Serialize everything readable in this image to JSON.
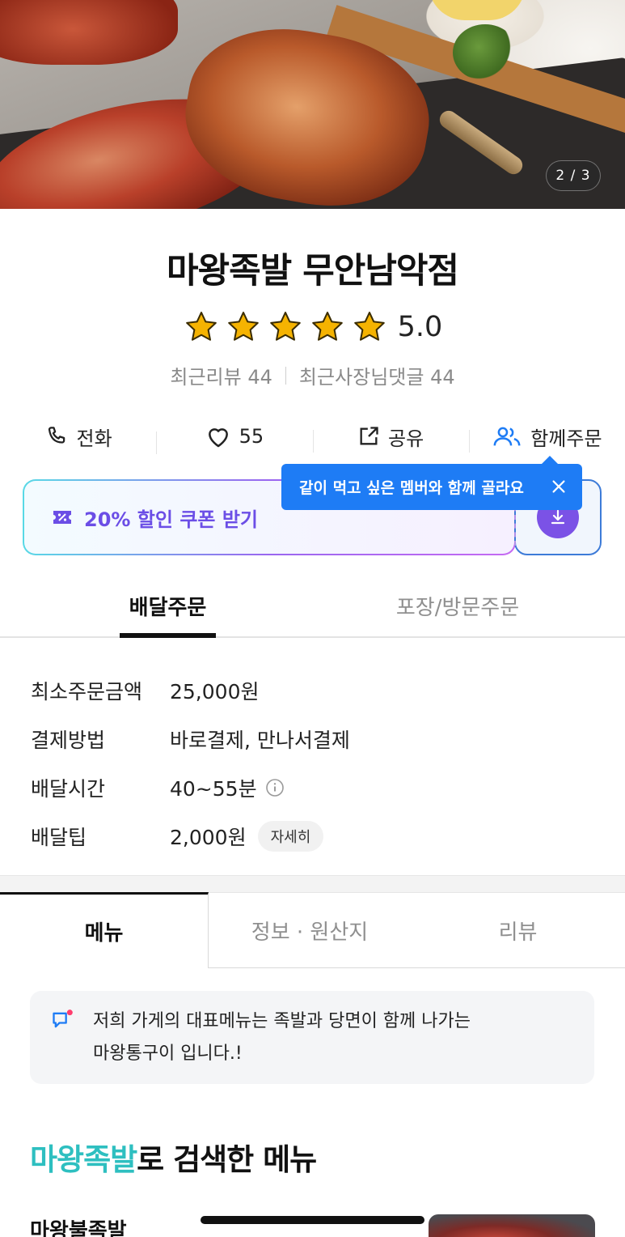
{
  "hero": {
    "counter": "2 / 3"
  },
  "store": {
    "name": "마왕족발 무안남악점",
    "rating": "5.0",
    "stars": 5,
    "recent_reviews": "최근리뷰 44",
    "owner_replies": "최근사장님댓글 44"
  },
  "actions": {
    "call": "전화",
    "like_count": "55",
    "share": "공유",
    "group_order": "함께주문"
  },
  "coupon": {
    "label": "20% 할인 쿠폰 받기"
  },
  "tooltip": {
    "text": "같이 먹고 싶은 멤버와 함께 골라요"
  },
  "order_tabs": {
    "delivery": "배달주문",
    "pickup": "포장/방문주문"
  },
  "info": {
    "rows": [
      {
        "key": "최소주문금액",
        "value": "25,000원"
      },
      {
        "key": "결제방법",
        "value": "바로결제, 만나서결제"
      },
      {
        "key": "배달시간",
        "value": "40~55분"
      },
      {
        "key": "배달팁",
        "value": "2,000원"
      }
    ],
    "detail_button": "자세히"
  },
  "content_tabs": {
    "menu": "메뉴",
    "info": "정보 · 원산지",
    "review": "리뷰"
  },
  "notice": {
    "line1": "저희 가게의 대표메뉴는 족발과 당면이 함께 나가는",
    "line2": "마왕통구이 입니다.!"
  },
  "search": {
    "keyword": "마왕족발",
    "suffix": "로 검색한 메뉴"
  },
  "menu_first": {
    "name": "마왕불족발"
  },
  "colors": {
    "accent_blue": "#1e7cf5",
    "coupon_purple": "#6b4ee6",
    "keyword_teal": "#2ebfc0",
    "star": "#f5b301"
  },
  "icons": [
    "phone-icon",
    "heart-icon",
    "share-icon",
    "group-icon",
    "coupon-icon",
    "download-icon",
    "close-icon",
    "info-icon",
    "notice-icon",
    "star-icon"
  ]
}
